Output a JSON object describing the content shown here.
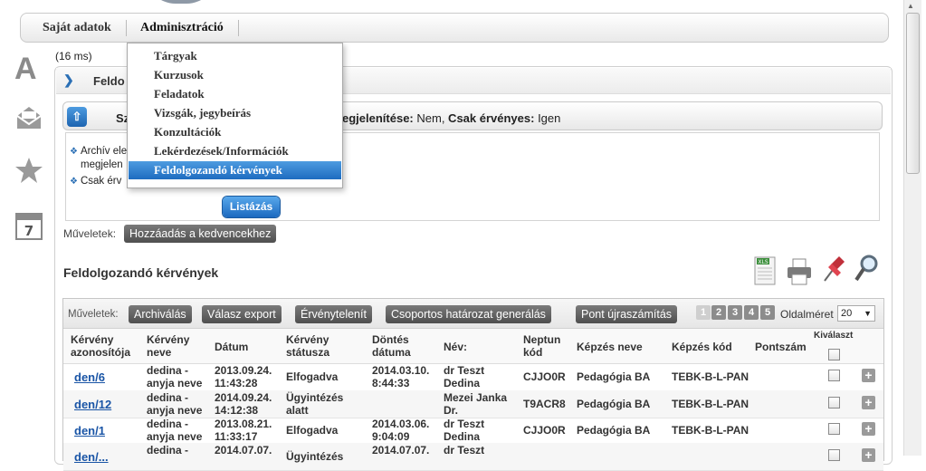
{
  "topmenu": {
    "item1": "Saját adatok",
    "item2": "Adminisztráció"
  },
  "timing": "(16 ms)",
  "dropdown": {
    "items": [
      {
        "label": "Tárgyak"
      },
      {
        "label": "Kurzusok"
      },
      {
        "label": "Feladatok"
      },
      {
        "label": "Vizsgák, jegybeírás"
      },
      {
        "label": "Konzultációk"
      },
      {
        "label": "Lekérdezések/Információk"
      },
      {
        "label": "Feldolgozandó kérvények"
      }
    ]
  },
  "panel": {
    "title_fragment": "Feldo"
  },
  "filter": {
    "sz_fragment": "Sz",
    "summary_prefix": "egjelenítése: ",
    "summary_value1": "Nem,",
    "summary_label2": " Csak érvényes:",
    "summary_value2": " Igen",
    "line1": "Archív ele",
    "line1b": "megjelen",
    "line2": "Csak érv",
    "list_button": "Listázás"
  },
  "ops_top": {
    "label": "Műveletek:",
    "add_fav": "Hozzáadás a kedvencekhez"
  },
  "section_title": "Feldolgozandó kérvények",
  "toolbar": {
    "label": "Műveletek:",
    "buttons": [
      "Archiválás",
      "Válasz export",
      "Érvénytelenít",
      "Csoportos határozat generálás",
      "Pont újraszámítás"
    ],
    "pages": [
      "1",
      "2",
      "3",
      "4",
      "5"
    ],
    "page_size_label": "Oldalméret",
    "page_size_value": "20"
  },
  "columns": {
    "id1": "Kérvény",
    "id2": "azonosítója",
    "name1": "Kérvény",
    "name2": "neve",
    "date": "Dátum",
    "status1": "Kérvény",
    "status2": "státusza",
    "decision1": "Döntés",
    "decision2": "dátuma",
    "person": "Név:",
    "neptun1": "Neptun",
    "neptun2": "kód",
    "program": "Képzés neve",
    "program_code": "Képzés kód",
    "points": "Pontszám",
    "select": "Kiválaszt"
  },
  "rows": [
    {
      "id": "den/6",
      "name1": "dedina -",
      "name2": "anyja neve",
      "date1": "2013.09.24.",
      "date2": "11:43:28",
      "status1": "Elfogadva",
      "status2": "",
      "dec1": "2014.03.10.",
      "dec2": "8:44:33",
      "person1": "dr Teszt",
      "person2": "Dedina",
      "neptun": "CJJO0R",
      "program": "Pedagógia BA",
      "code": "TEBK-B-L-PAN"
    },
    {
      "id": "den/12",
      "name1": "dedina -",
      "name2": "anyja neve",
      "date1": "2014.09.24.",
      "date2": "14:12:38",
      "status1": "Ügyintézés",
      "status2": "alatt",
      "dec1": "",
      "dec2": "",
      "person1": "Mezei Janka",
      "person2": "Dr.",
      "neptun": "T9ACR8",
      "program": "Pedagógia BA",
      "code": "TEBK-B-L-PAN"
    },
    {
      "id": "den/1",
      "name1": "dedina -",
      "name2": "anyja neve",
      "date1": "2013.08.21.",
      "date2": "11:33:17",
      "status1": "Elfogadva",
      "status2": "",
      "dec1": "2014.03.06.",
      "dec2": "9:04:09",
      "person1": "dr Teszt",
      "person2": "Dedina",
      "neptun": "CJJO0R",
      "program": "Pedagógia BA",
      "code": "TEBK-B-L-PAN"
    },
    {
      "id": "den/...",
      "name1": "dedina -",
      "name2": "",
      "date1": "2014.07.07.",
      "date2": "",
      "status1": "Ügyintézés",
      "status2": "",
      "dec1": "2014.07.07.",
      "dec2": "",
      "person1": "dr Teszt",
      "person2": "",
      "neptun": "",
      "program": "",
      "code": ""
    }
  ],
  "colors": {
    "accent_blue": "#1c69bf",
    "link": "#1a55a6",
    "selected_menu": "#2f7fd0"
  }
}
